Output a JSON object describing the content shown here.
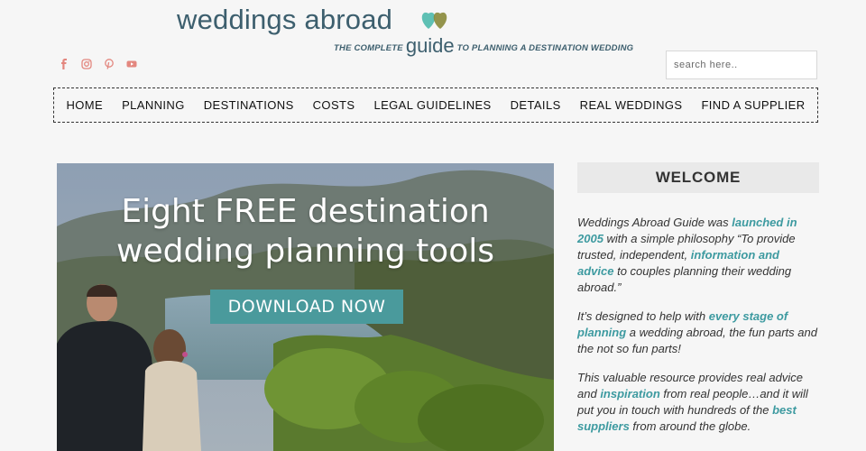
{
  "logo": {
    "main": "weddings abroad",
    "tag_before": "THE COMPLETE",
    "tag_guide": "guide",
    "tag_after": "TO PLANNING A DESTINATION WEDDING",
    "heart_colors": [
      "#5ec0b4",
      "#8a8a3a"
    ]
  },
  "social": [
    {
      "name": "facebook-icon",
      "color": "#e3877f"
    },
    {
      "name": "instagram-icon",
      "color": "#e3877f"
    },
    {
      "name": "pinterest-icon",
      "color": "#e3877f"
    },
    {
      "name": "youtube-icon",
      "color": "#e3877f"
    }
  ],
  "search": {
    "placeholder": "search here.."
  },
  "nav": {
    "items": [
      "HOME",
      "PLANNING",
      "DESTINATIONS",
      "COSTS",
      "LEGAL GUIDELINES",
      "DETAILS",
      "REAL WEDDINGS",
      "FIND A SUPPLIER"
    ]
  },
  "hero": {
    "title_line1": "Eight FREE destination",
    "title_line2": "wedding planning tools",
    "button": "DOWNLOAD NOW"
  },
  "sidebar": {
    "heading": "WELCOME",
    "p1": {
      "t1": "Weddings Abroad Guide was ",
      "l1": "launched in 2005",
      "t2": " with a simple philosophy “To provide trusted, independent, ",
      "l2": "information and advice",
      "t3": " to couples planning their wedding abroad.”"
    },
    "p2": {
      "t1": "It’s designed to help with ",
      "l1": "every stage of planning",
      "t2": " a wedding abroad, the fun parts and the not so fun parts!"
    },
    "p3": {
      "t1": "This valuable resource provides real advice and ",
      "l1": "inspiration",
      "t2": " from real people…and it will put you in touch with hundreds of the ",
      "l2": "best suppliers",
      "t3": " from around the globe."
    }
  },
  "colors": {
    "accent": "#3d9aa0",
    "logo": "#3d5f6e",
    "button": "#4a9a9c"
  }
}
